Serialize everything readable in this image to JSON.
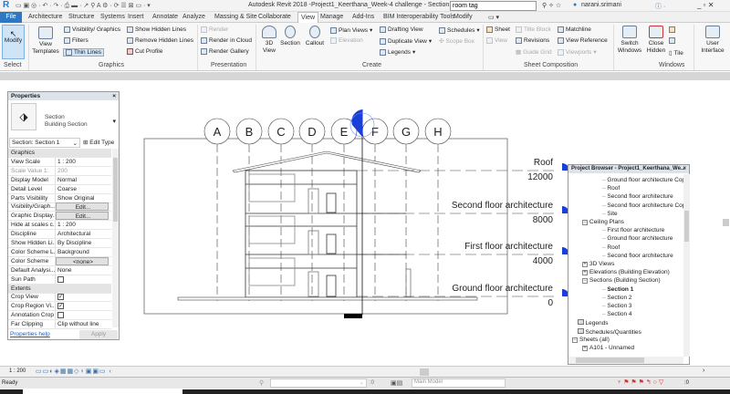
{
  "app": {
    "title": "Autodesk Revit 2018 -",
    "project_title": "Project1_Keerthana_Week-4 challenge - Section: Section 1",
    "search_value": "room tag",
    "user": "narani.srimani"
  },
  "tabs": [
    "File",
    "Architecture",
    "Structure",
    "Systems",
    "Insert",
    "Annotate",
    "Analyze",
    "Massing & Site",
    "Collaborate",
    "View",
    "Manage",
    "Add-Ins",
    "BIM Interoperability Tools",
    "Modify"
  ],
  "active_tab": "View",
  "ribbon": {
    "select": {
      "modify": "Modify",
      "label": "Select"
    },
    "graphics": {
      "view_templates": "View Templates",
      "visibility": "Visibility/ Graphics",
      "filters": "Filters",
      "thin_lines": "Thin Lines",
      "show_hidden": "Show Hidden Lines",
      "remove_hidden": "Remove Hidden Lines",
      "cut_profile": "Cut Profile",
      "label": "Graphics"
    },
    "presentation": {
      "render": "Render",
      "render_cloud": "Render in Cloud",
      "render_gallery": "Render Gallery",
      "label": "Presentation"
    },
    "create": {
      "view_3d": "3D View",
      "section": "Section",
      "callout": "Callout",
      "plan_views": "Plan Views",
      "elevation": "Elevation",
      "drafting": "Drafting View",
      "duplicate": "Duplicate View",
      "legends": "Legends",
      "schedules": "Schedules",
      "scope_box": "Scope Box",
      "label": "Create"
    },
    "sheet": {
      "sheet": "Sheet",
      "title_block": "Title Block",
      "matchline": "Matchline",
      "view": "View",
      "revisions": "Revisions",
      "view_reference": "View Reference",
      "guide_grid": "Guide Grid",
      "viewports": "Viewports",
      "label": "Sheet Composition"
    },
    "windows": {
      "switch": "Switch Windows",
      "close_hidden": "Close Hidden",
      "tile": "Tile",
      "label": "Windows"
    },
    "ui": {
      "user_interface": "User Interface"
    }
  },
  "properties": {
    "title": "Properties",
    "type_family": "Section",
    "type_name": "Building Section",
    "selector": "Section: Section 1",
    "edit_type": "Edit Type",
    "rows": [
      {
        "h": "Graphics"
      },
      {
        "k": "View Scale",
        "v": "1 : 200"
      },
      {
        "k": "Scale Value  1:",
        "v": "200",
        "dim": true
      },
      {
        "k": "Display Model",
        "v": "Normal"
      },
      {
        "k": "Detail Level",
        "v": "Coarse"
      },
      {
        "k": "Parts Visibility",
        "v": "Show Original"
      },
      {
        "k": "Visibility/Graph...",
        "v": "Edit...",
        "btn": true
      },
      {
        "k": "Graphic Display...",
        "v": "Edit...",
        "btn": true
      },
      {
        "k": "Hide at scales c...",
        "v": "1 : 200"
      },
      {
        "k": "Discipline",
        "v": "Architectural"
      },
      {
        "k": "Show Hidden Li...",
        "v": "By Discipline"
      },
      {
        "k": "Color Scheme L...",
        "v": "Background"
      },
      {
        "k": "Color Scheme",
        "v": "<none>",
        "btn": true
      },
      {
        "k": "Default Analysi...",
        "v": "None"
      },
      {
        "k": "Sun Path",
        "cb": false
      },
      {
        "h": "Extents"
      },
      {
        "k": "Crop View",
        "cb": true
      },
      {
        "k": "Crop Region Vi...",
        "cb": true
      },
      {
        "k": "Annotation Crop",
        "cb": false
      },
      {
        "k": "Far Clipping",
        "v": "Clip without line"
      }
    ],
    "help": "Properties help",
    "apply": "Apply"
  },
  "drawing": {
    "grids": [
      "A",
      "B",
      "C",
      "D",
      "E",
      "F",
      "G",
      "H"
    ],
    "levels": [
      {
        "name": "Roof",
        "elev": "12000"
      },
      {
        "name": "Second floor architecture",
        "elev": "8000"
      },
      {
        "name": "First floor architecture",
        "elev": "4000"
      },
      {
        "name": "Ground floor architecture",
        "elev": "0"
      }
    ]
  },
  "browser": {
    "title": "Project Browser - Project1_Keerthana_We...",
    "items": [
      {
        "t": "Ground floor architecture Copy",
        "d": 3
      },
      {
        "t": "Roof",
        "d": 3
      },
      {
        "t": "Second floor architecture",
        "d": 3
      },
      {
        "t": "Second floor architecture Copy",
        "d": 3
      },
      {
        "t": "Site",
        "d": 3
      },
      {
        "t": "Ceiling Plans",
        "d": 1,
        "e": "-"
      },
      {
        "t": "First floor architecture",
        "d": 3
      },
      {
        "t": "Ground floor architecture",
        "d": 3
      },
      {
        "t": "Roof",
        "d": 3
      },
      {
        "t": "Second floor architecture",
        "d": 3
      },
      {
        "t": "3D Views",
        "d": 1,
        "e": "+"
      },
      {
        "t": "Elevations (Building Elevation)",
        "d": 1,
        "e": "+"
      },
      {
        "t": "Sections (Building Section)",
        "d": 1,
        "e": "-"
      },
      {
        "t": "Section 1",
        "d": 3,
        "b": true
      },
      {
        "t": "Section 2",
        "d": 3
      },
      {
        "t": "Section 3",
        "d": 3
      },
      {
        "t": "Section 4",
        "d": 3
      },
      {
        "t": "Legends",
        "d": 0.5
      },
      {
        "t": "Schedules/Quantities",
        "d": 0.5
      },
      {
        "t": "Sheets (all)",
        "d": 0,
        "e": "-"
      },
      {
        "t": "A101 - Unnamed",
        "d": 1,
        "e": "+"
      }
    ]
  },
  "viewbar": {
    "scale": "1 : 200"
  },
  "status": {
    "text": "Ready",
    "workset": ":0",
    "model": "Main Model",
    "filter": ":0"
  },
  "colors": {
    "accent": "#2f78c1",
    "section_head": "#1a3fd6"
  }
}
